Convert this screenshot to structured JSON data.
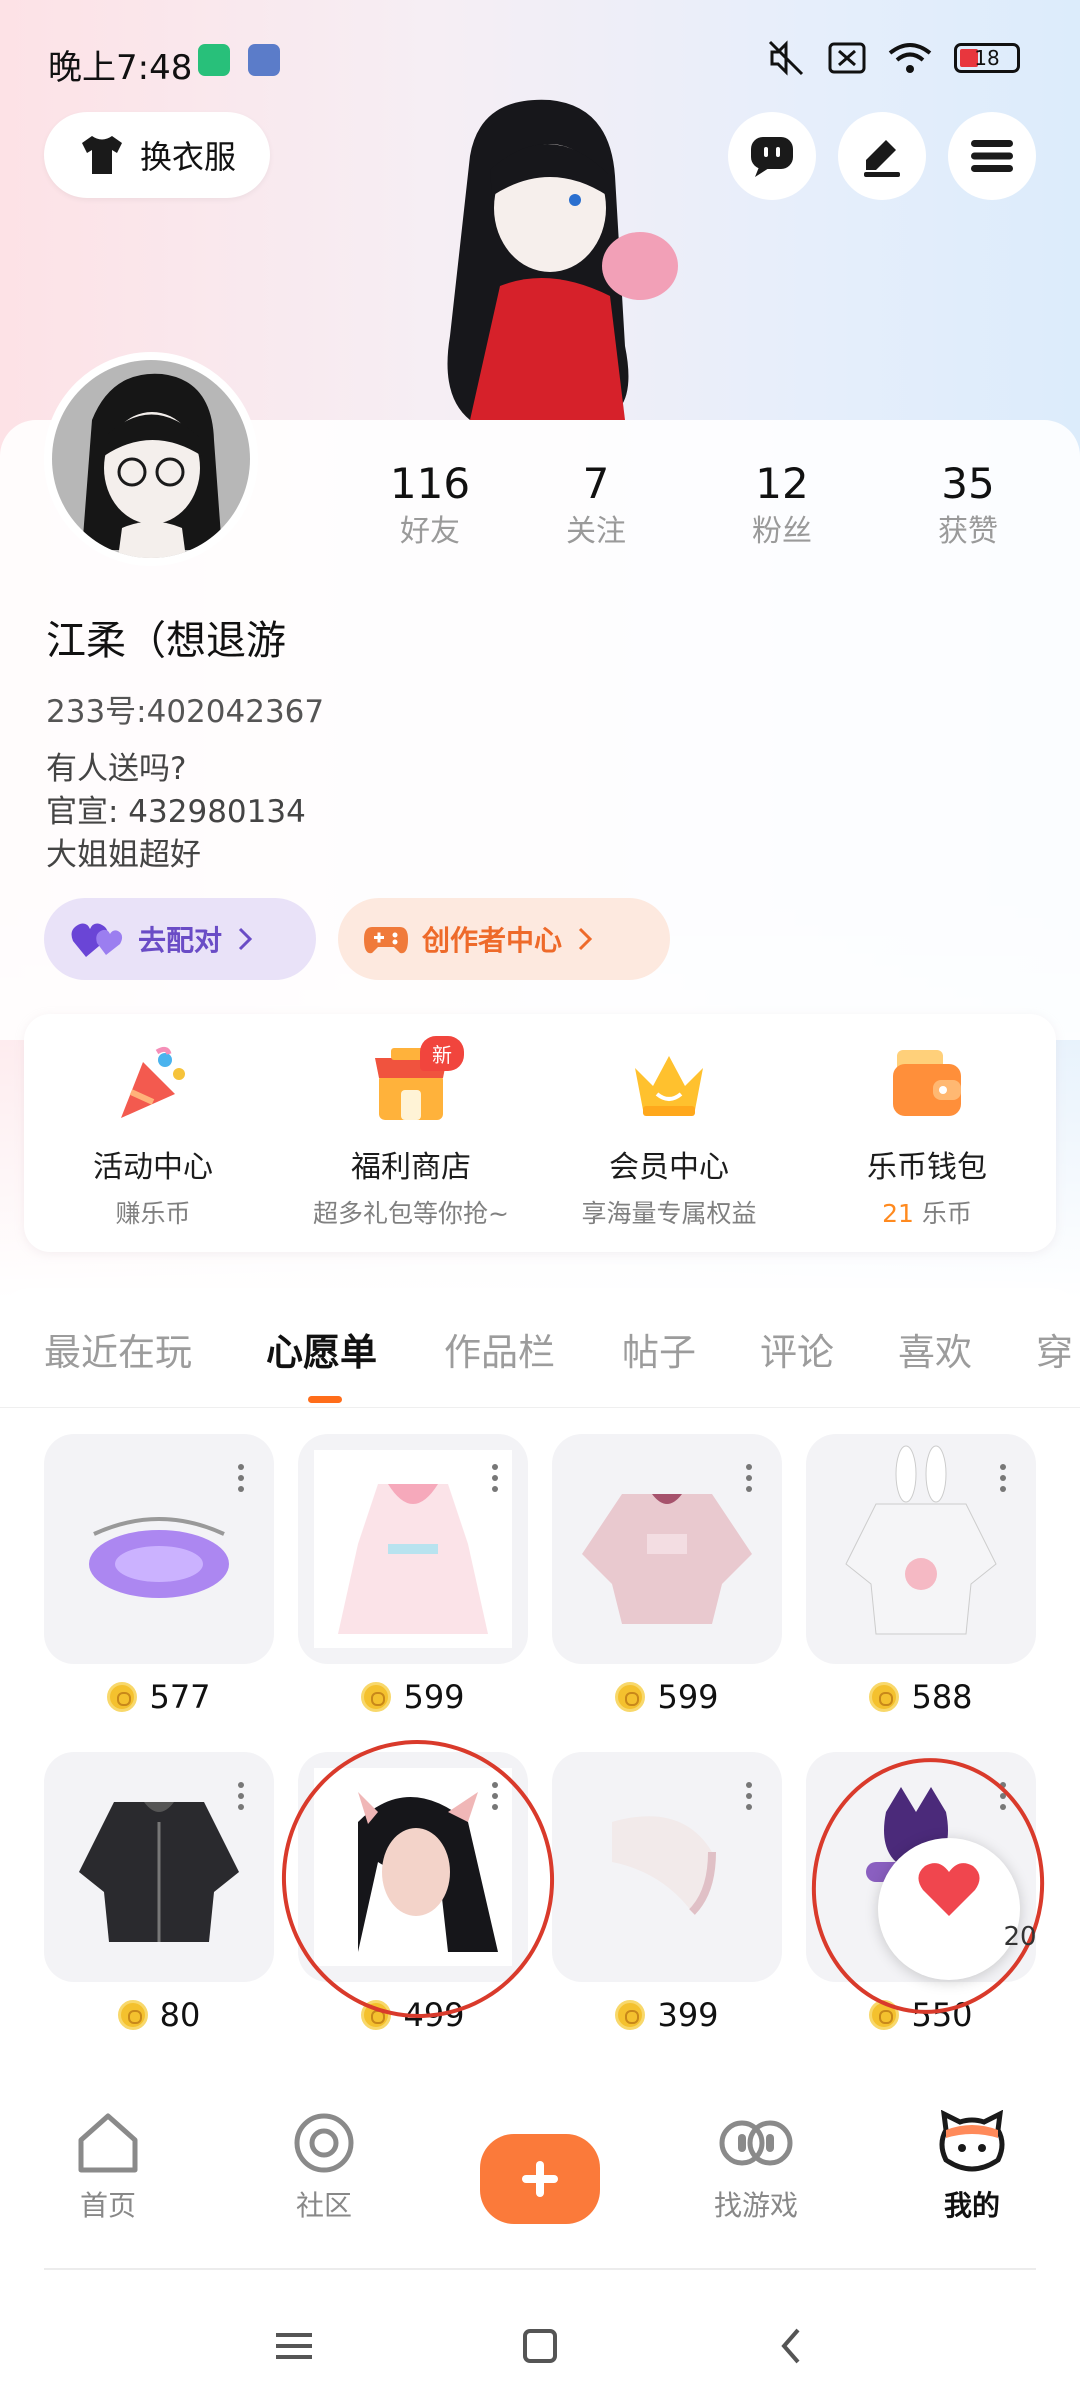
{
  "status_bar": {
    "time": "晚上7:48",
    "battery": "18"
  },
  "header": {
    "outfit_label": "换衣服"
  },
  "profile": {
    "stats": [
      {
        "value": "116",
        "label": "好友"
      },
      {
        "value": "7",
        "label": "关注"
      },
      {
        "value": "12",
        "label": "粉丝"
      },
      {
        "value": "35",
        "label": "获赞"
      }
    ],
    "username": "江柔（想退游",
    "uid": "233号:402042367",
    "bio": [
      "有人送吗?",
      "官宣: 432980134",
      "大姐姐超好"
    ],
    "pair_label": "去配对",
    "creator_label": "创作者中心"
  },
  "services": {
    "new_badge": "新",
    "items": [
      {
        "name": "活动中心",
        "sub": "赚乐币"
      },
      {
        "name": "福利商店",
        "sub": "超多礼包等你抢~"
      },
      {
        "name": "会员中心",
        "sub": "享海量专属权益"
      },
      {
        "name": "乐币钱包",
        "sub_num": "21",
        "sub_unit": "乐币"
      }
    ]
  },
  "tabs": [
    "最近在玩",
    "心愿单",
    "作品栏",
    "帖子",
    "评论",
    "喜欢",
    "穿"
  ],
  "wishlist": [
    {
      "price": "577"
    },
    {
      "price": "599"
    },
    {
      "price": "599"
    },
    {
      "price": "588"
    },
    {
      "price": "80"
    },
    {
      "price": "499"
    },
    {
      "price": "399"
    },
    {
      "price": "550"
    }
  ],
  "like_count": "20",
  "bottom_nav": [
    "首页",
    "社区",
    "找游戏",
    "我的"
  ],
  "colors": {
    "accent": "#fb7a3a",
    "pair_bg": "#e9e2f8",
    "creator_bg": "#fde9df",
    "tab_indicator": "#ff6d1a",
    "annotation": "#d93a2b"
  }
}
